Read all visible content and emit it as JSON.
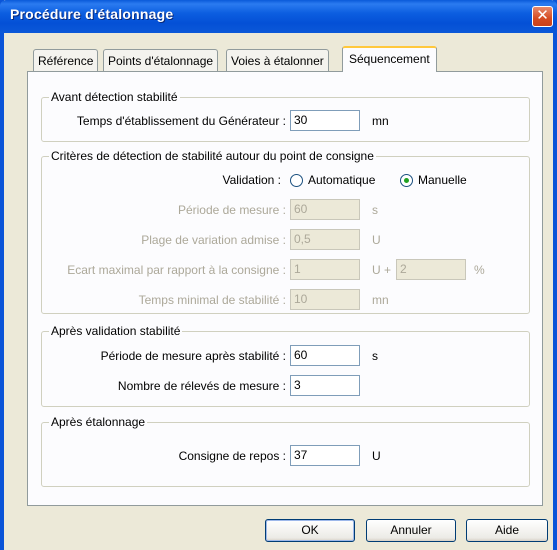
{
  "window": {
    "title": "Procédure d'étalonnage",
    "close_glyph": "✕"
  },
  "tabs": [
    {
      "label": "Référence"
    },
    {
      "label": "Points d'étalonnage"
    },
    {
      "label": "Voies à étalonner"
    },
    {
      "label": "Séquencement",
      "active": true
    }
  ],
  "group_avant": {
    "title": "Avant détection stabilité",
    "temps_label": "Temps d'établissement du Générateur :",
    "temps_value": "30",
    "temps_unit": "mn"
  },
  "group_criteres": {
    "title": "Critères de détection de stabilité autour du point de consigne",
    "validation_label": "Validation :",
    "radio_auto": "Automatique",
    "radio_manuelle": "Manuelle",
    "selected": "Manuelle",
    "periode_label": "Période de mesure :",
    "periode_value": "60",
    "periode_unit": "s",
    "plage_label": "Plage de variation admise :",
    "plage_value": "0,5",
    "plage_unit": "U",
    "ecart_label": "Ecart maximal par rapport à la consigne :",
    "ecart_value1": "1",
    "ecart_mid": "U +",
    "ecart_value2": "2",
    "ecart_unit": "%",
    "temps_min_label": "Temps minimal de stabilité :",
    "temps_min_value": "10",
    "temps_min_unit": "mn"
  },
  "group_apres_validation": {
    "title": "Après validation stabilité",
    "periode_label": "Période de mesure après stabilité :",
    "periode_value": "60",
    "periode_unit": "s",
    "nombre_label": "Nombre de rélevés de mesure :",
    "nombre_value": "3"
  },
  "group_apres_etalonnage": {
    "title": "Après étalonnage",
    "consigne_label": "Consigne de repos :",
    "consigne_value": "37",
    "consigne_unit": "U"
  },
  "buttons": {
    "ok": "OK",
    "annuler": "Annuler",
    "aide": "Aide"
  }
}
